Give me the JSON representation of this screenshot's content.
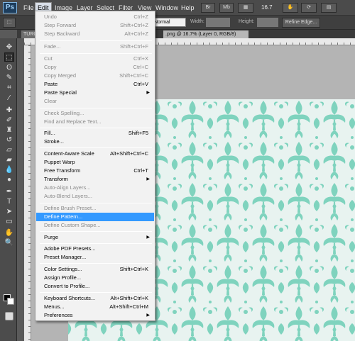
{
  "app": {
    "logo": "Ps"
  },
  "menubar": {
    "items": [
      {
        "label": "File"
      },
      {
        "label": "Edit"
      },
      {
        "label": "Image"
      },
      {
        "label": "Layer"
      },
      {
        "label": "Select"
      },
      {
        "label": "Filter"
      },
      {
        "label": "View"
      },
      {
        "label": "Window"
      },
      {
        "label": "Help"
      }
    ],
    "buttons": [
      "Br",
      "Mb"
    ],
    "zoom": "16.7"
  },
  "options_bar": {
    "style_value": "Normal",
    "width_label": "Width:",
    "height_label": "Height:",
    "refine_edge": "Refine Edge..."
  },
  "document_tabs": [
    {
      "label": "TURQ"
    },
    {
      "label": ".png @ 16.7% (Layer 0, RGB/8)"
    }
  ],
  "edit_menu": {
    "items": [
      {
        "label": "Undo",
        "shortcut": "Ctrl+Z",
        "disabled": true
      },
      {
        "label": "Step Forward",
        "shortcut": "Shift+Ctrl+Z",
        "disabled": true
      },
      {
        "label": "Step Backward",
        "shortcut": "Alt+Ctrl+Z",
        "disabled": true
      },
      {
        "label": "Fade...",
        "shortcut": "Shift+Ctrl+F",
        "disabled": true
      },
      {
        "label": "Cut",
        "shortcut": "Ctrl+X",
        "disabled": true
      },
      {
        "label": "Copy",
        "shortcut": "Ctrl+C",
        "disabled": true
      },
      {
        "label": "Copy Merged",
        "shortcut": "Shift+Ctrl+C",
        "disabled": true
      },
      {
        "label": "Paste",
        "shortcut": "Ctrl+V",
        "disabled": false
      },
      {
        "label": "Paste Special",
        "shortcut": "",
        "disabled": false,
        "submenu": true
      },
      {
        "label": "Clear",
        "shortcut": "",
        "disabled": true
      },
      {
        "label": "Check Spelling...",
        "shortcut": "",
        "disabled": true
      },
      {
        "label": "Find and Replace Text...",
        "shortcut": "",
        "disabled": true
      },
      {
        "label": "Fill...",
        "shortcut": "Shift+F5",
        "disabled": false
      },
      {
        "label": "Stroke...",
        "shortcut": "",
        "disabled": false
      },
      {
        "label": "Content-Aware Scale",
        "shortcut": "Alt+Shift+Ctrl+C",
        "disabled": false
      },
      {
        "label": "Puppet Warp",
        "shortcut": "",
        "disabled": false
      },
      {
        "label": "Free Transform",
        "shortcut": "Ctrl+T",
        "disabled": false
      },
      {
        "label": "Transform",
        "shortcut": "",
        "disabled": false,
        "submenu": true
      },
      {
        "label": "Auto-Align Layers...",
        "shortcut": "",
        "disabled": true
      },
      {
        "label": "Auto-Blend Layers...",
        "shortcut": "",
        "disabled": true
      },
      {
        "label": "Define Brush Preset...",
        "shortcut": "",
        "disabled": true
      },
      {
        "label": "Define Pattern...",
        "shortcut": "",
        "disabled": false,
        "highlighted": true
      },
      {
        "label": "Define Custom Shape...",
        "shortcut": "",
        "disabled": true
      },
      {
        "label": "Purge",
        "shortcut": "",
        "disabled": false,
        "submenu": true
      },
      {
        "label": "Adobe PDF Presets...",
        "shortcut": "",
        "disabled": false
      },
      {
        "label": "Preset Manager...",
        "shortcut": "",
        "disabled": false
      },
      {
        "label": "Color Settings...",
        "shortcut": "Shift+Ctrl+K",
        "disabled": false
      },
      {
        "label": "Assign Profile...",
        "shortcut": "",
        "disabled": false
      },
      {
        "label": "Convert to Profile...",
        "shortcut": "",
        "disabled": false
      },
      {
        "label": "Keyboard Shortcuts...",
        "shortcut": "Alt+Shift+Ctrl+K",
        "disabled": false
      },
      {
        "label": "Menus...",
        "shortcut": "Alt+Shift+Ctrl+M",
        "disabled": false
      },
      {
        "label": "Preferences",
        "shortcut": "",
        "disabled": false,
        "submenu": true
      }
    ]
  },
  "toolbar": {
    "tools": [
      "move-tool-icon",
      "marquee-tool-icon",
      "lasso-tool-icon",
      "quick-select-tool-icon",
      "crop-tool-icon",
      "eyedropper-tool-icon",
      "healing-brush-icon",
      "brush-tool-icon",
      "clone-stamp-icon",
      "history-brush-icon",
      "eraser-tool-icon",
      "gradient-tool-icon",
      "blur-tool-icon",
      "dodge-tool-icon",
      "pen-tool-icon",
      "type-tool-icon",
      "path-select-icon",
      "shape-tool-icon",
      "hand-tool-icon",
      "zoom-tool-icon"
    ]
  },
  "colors": {
    "pattern_fg": "#7fd3be",
    "pattern_bg": "#e8f3f0",
    "menu_highlight": "#3399ff",
    "foreground_swatch": "#000000",
    "background_swatch": "#ffffff"
  }
}
